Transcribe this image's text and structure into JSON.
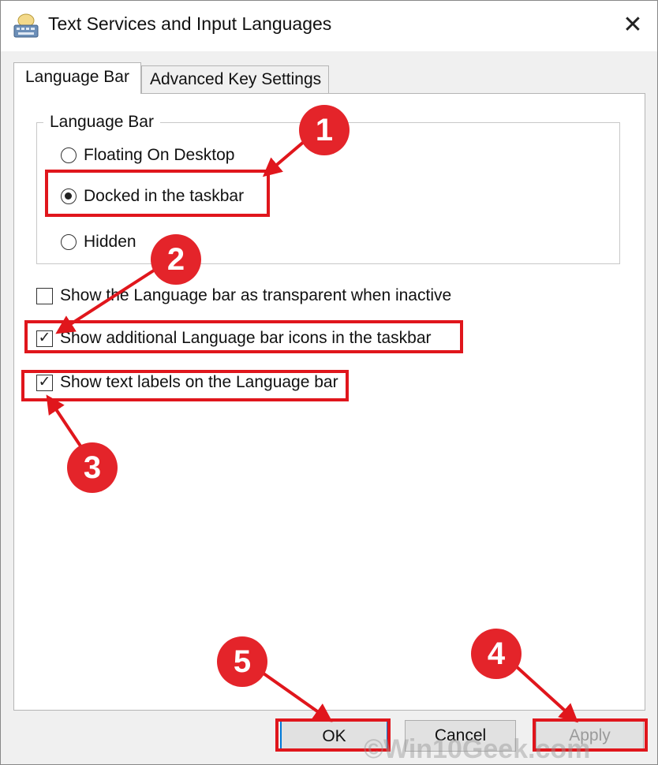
{
  "window": {
    "title": "Text Services and Input Languages",
    "close_glyph": "✕",
    "icon": "keyboard-icon"
  },
  "tabs": [
    {
      "label": "Language Bar",
      "active": true
    },
    {
      "label": "Advanced Key Settings",
      "active": false
    }
  ],
  "language_bar_group": {
    "legend": "Language Bar",
    "options": [
      {
        "label": "Floating On Desktop",
        "checked": false
      },
      {
        "label": "Docked in the taskbar",
        "checked": true
      },
      {
        "label": "Hidden",
        "checked": false
      }
    ]
  },
  "checkboxes": [
    {
      "label": "Show the Language bar as transparent when inactive",
      "checked": false
    },
    {
      "label": "Show additional Language bar icons in the taskbar",
      "checked": true
    },
    {
      "label": "Show text labels on the Language bar",
      "checked": true
    }
  ],
  "checkmark_glyph": "✓",
  "buttons": {
    "ok": "OK",
    "cancel": "Cancel",
    "apply": "Apply"
  },
  "annotations": {
    "color": "#e0161c",
    "steps": [
      "1",
      "2",
      "3",
      "4",
      "5"
    ]
  },
  "watermark": "©Win10Geek.com"
}
